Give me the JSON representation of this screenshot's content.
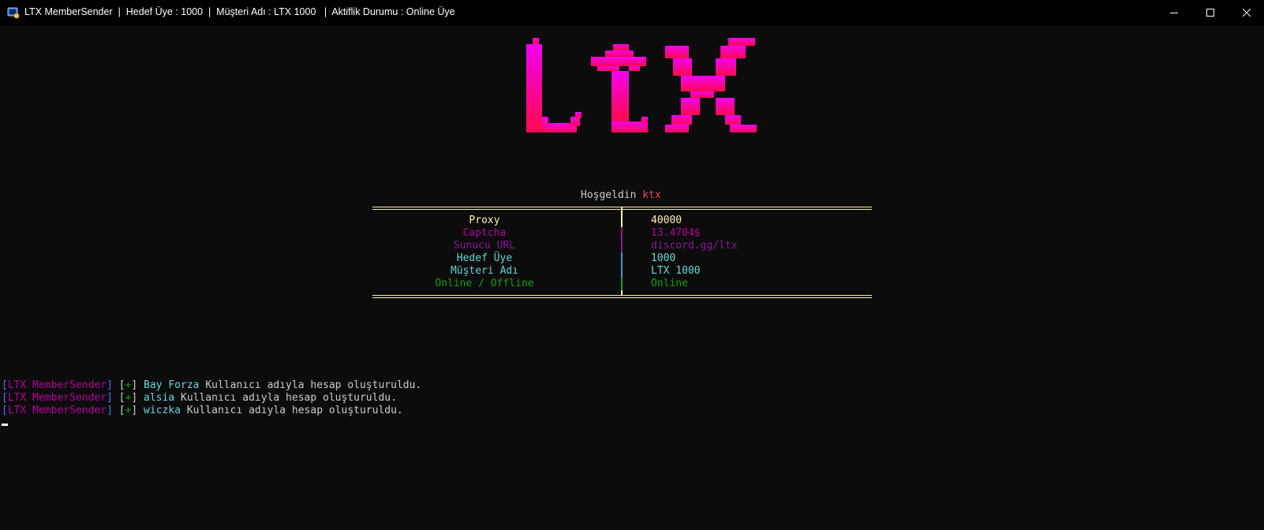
{
  "window": {
    "title": "LTX MemberSender  |  Hedef Üye : 1000  |  Müşteri Adı : LTX 1000   |  Aktiflik Durumu : Online Üye"
  },
  "logo": {
    "text": "LTX",
    "gradient_top": "#f200f0",
    "gradient_bottom": "#ff0a4e"
  },
  "welcome": {
    "prefix": "Hoşgeldin",
    "name": "ktx"
  },
  "stats": [
    {
      "label": "Proxy",
      "value": "40000",
      "color": "#f9f1a5",
      "separator": "#f9f1a5"
    },
    {
      "label": "Captcha",
      "value": "13.4704$",
      "color": "#b4009e",
      "separator": "#b4009e"
    },
    {
      "label": "Sunucu URL",
      "value": "discord.gg/ltx",
      "color": "#881798",
      "separator": "#881798"
    },
    {
      "label": "Hedef Üye",
      "value": "1000",
      "color": "#61d6d6",
      "separator": "#3a96dd"
    },
    {
      "label": "Müşteri Adı",
      "value": "LTX 1000",
      "color": "#61d6d6",
      "separator": "#3a96dd"
    },
    {
      "label": "Online / Offline",
      "value": "Online",
      "color": "#13a10e",
      "separator": "#13a10e"
    }
  ],
  "log": {
    "source": "LTX MemberSender",
    "marker": "+",
    "message": "Kullanıcı adıyla hesap oluşturuldu.",
    "users": [
      "Bay Forza",
      "alsia",
      "wiczka"
    ]
  },
  "colors": {
    "background": "#0c0c0c",
    "titlebar": "#000000",
    "bracket": "#3b78ff",
    "source": "#b4009e",
    "marker": "#13a10e",
    "username": "#61d6d6"
  }
}
